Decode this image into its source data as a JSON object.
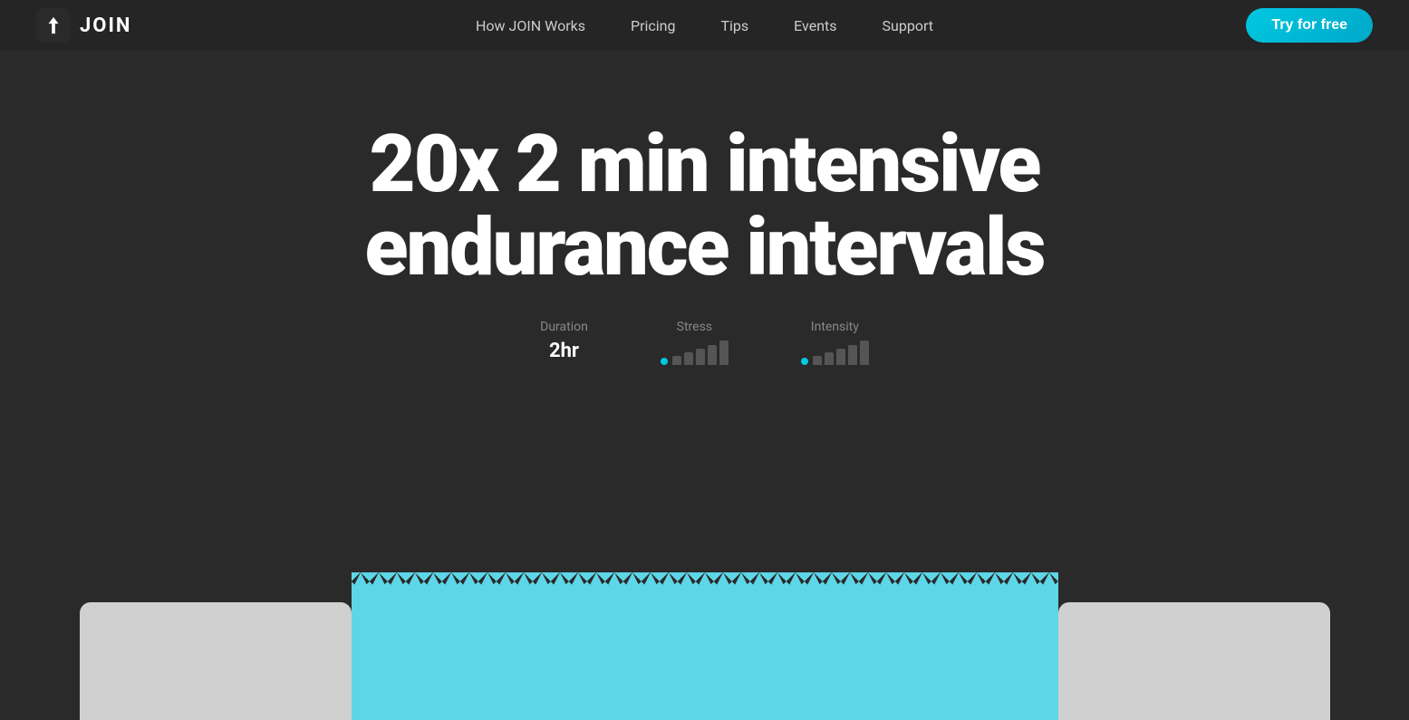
{
  "nav": {
    "logo_text": "JOIN",
    "links": [
      {
        "label": "How JOIN Works",
        "id": "how-join-works"
      },
      {
        "label": "Pricing",
        "id": "pricing"
      },
      {
        "label": "Tips",
        "id": "tips"
      },
      {
        "label": "Events",
        "id": "events"
      },
      {
        "label": "Support",
        "id": "support"
      }
    ],
    "cta_label": "Try for free"
  },
  "hero": {
    "title_line1": "20x 2 min intensive",
    "title_line2": "endurance intervals",
    "stats": {
      "duration": {
        "label": "Duration",
        "value": "2hr"
      },
      "stress": {
        "label": "Stress",
        "bars": [
          0.3,
          0.5,
          0.65,
          0.8,
          0.95
        ]
      },
      "intensity": {
        "label": "Intensity",
        "bars": [
          0.3,
          0.5,
          0.65,
          0.8,
          0.95
        ]
      }
    }
  },
  "colors": {
    "accent": "#00c8e0",
    "background": "#2a2a2a",
    "nav_bg": "#252525",
    "card_cyan": "#5dd6e8",
    "card_grey": "#d0d0d0",
    "text_muted": "#888888"
  }
}
